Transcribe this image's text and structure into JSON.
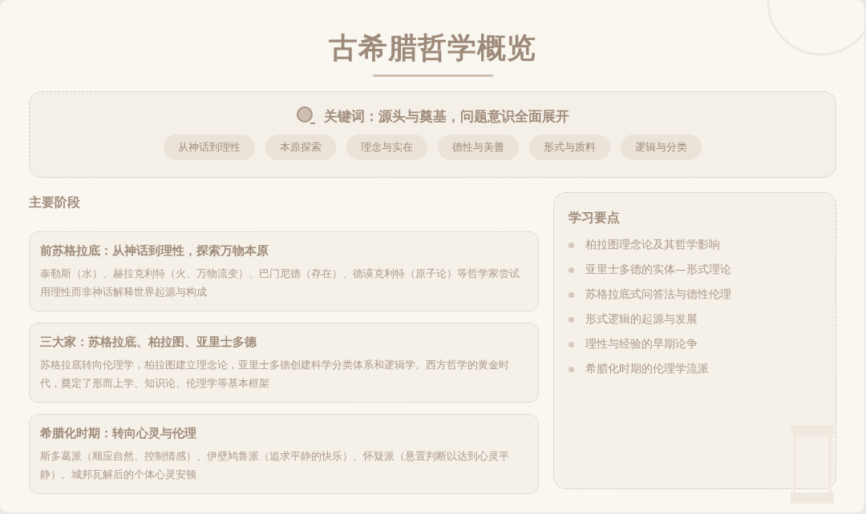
{
  "title": "古希腊哲学概览",
  "keywords": {
    "headline": "关键词：源头与奠基，问题意识全面展开",
    "tags": [
      "从神话到理性",
      "本原探索",
      "理念与实在",
      "德性与美善",
      "形式与质料",
      "逻辑与分类"
    ]
  },
  "stages": {
    "heading": "主要阶段",
    "cards": [
      {
        "title": "前苏格拉底：从神话到理性，探索万物本原",
        "body": "泰勒斯（水）、赫拉克利特（火、万物流变）、巴门尼德（存在）、德谟克利特（原子论）等哲学家尝试用理性而非神话解释世界起源与构成"
      },
      {
        "title": "三大家：苏格拉底、柏拉图、亚里士多德",
        "body": "苏格拉底转向伦理学，柏拉图建立理念论，亚里士多德创建科学分类体系和逻辑学。西方哲学的黄金时代，奠定了形而上学、知识论、伦理学等基本框架"
      },
      {
        "title": "希腊化时期：转向心灵与伦理",
        "body": "斯多葛派（顺应自然、控制情感）、伊壁鸠鲁派（追求平静的快乐）、怀疑派（悬置判断以达到心灵平静）。城邦瓦解后的个体心灵安顿"
      }
    ]
  },
  "key_points": {
    "heading": "学习要点",
    "items": [
      "柏拉图理念论及其哲学影响",
      "亚里士多德的实体—形式理论",
      "苏格拉底式问答法与德性伦理",
      "形式逻辑的起源与发展",
      "理性与经验的早期论争",
      "希腊化时期的伦理学流派"
    ]
  }
}
